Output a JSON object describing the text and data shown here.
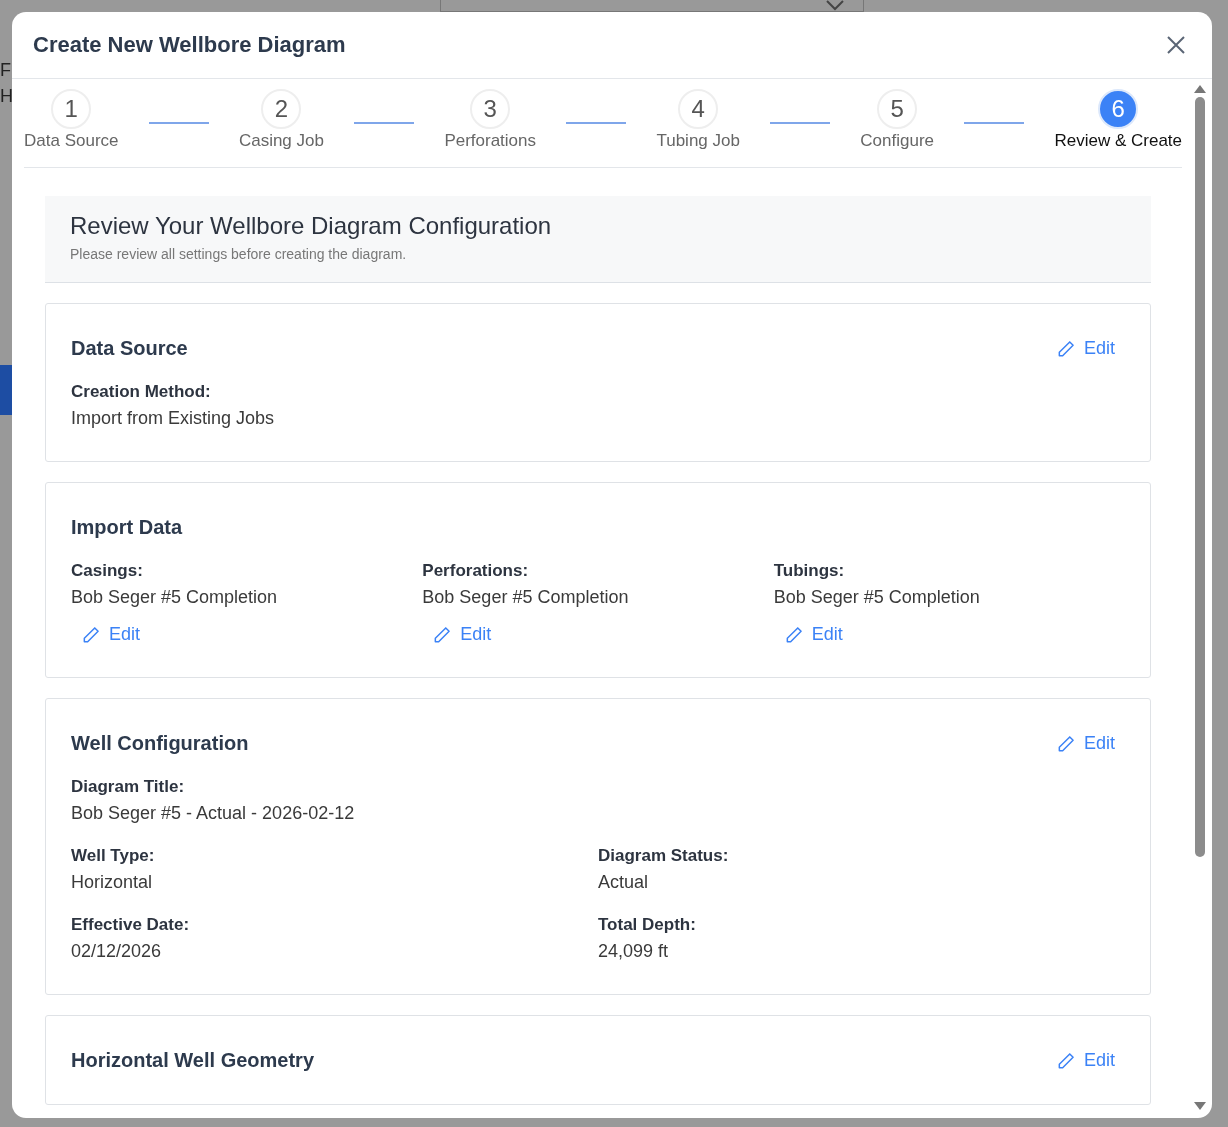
{
  "background": {
    "fragments": [
      "F",
      "H"
    ]
  },
  "dialog": {
    "title": "Create New Wellbore Diagram"
  },
  "steps": [
    {
      "number": "1",
      "label": "Data Source",
      "selected": false
    },
    {
      "number": "2",
      "label": "Casing Job",
      "selected": false
    },
    {
      "number": "3",
      "label": "Perforations",
      "selected": false
    },
    {
      "number": "4",
      "label": "Tubing Job",
      "selected": false
    },
    {
      "number": "5",
      "label": "Configure",
      "selected": false
    },
    {
      "number": "6",
      "label": "Review & Create",
      "selected": true
    }
  ],
  "review_header": {
    "title": "Review Your Wellbore Diagram Configuration",
    "subtitle": "Please review all settings before creating the diagram."
  },
  "sections": [
    {
      "title": "Data Source",
      "edit": "Edit",
      "rows": [
        [
          {
            "label": "Creation Method:",
            "value": "Import from Existing Jobs"
          }
        ]
      ]
    },
    {
      "title": "Import Data",
      "rows": [
        [
          {
            "label": "Casings:",
            "value": "Bob Seger #5 Completion",
            "edit": "Edit"
          },
          {
            "label": "Perforations:",
            "value": "Bob Seger #5 Completion",
            "edit": "Edit"
          },
          {
            "label": "Tubings:",
            "value": "Bob Seger #5 Completion",
            "edit": "Edit"
          }
        ]
      ]
    },
    {
      "title": "Well Configuration",
      "edit": "Edit",
      "rows": [
        [
          {
            "label": "Diagram Title:",
            "value": "Bob Seger #5 - Actual - 2026-02-12"
          }
        ],
        [
          {
            "label": "Well Type:",
            "value": "Horizontal"
          },
          {
            "label": "Diagram Status:",
            "value": "Actual"
          }
        ],
        [
          {
            "label": "Effective Date:",
            "value": "02/12/2026"
          },
          {
            "label": "Total Depth:",
            "value": "24,099 ft"
          }
        ]
      ]
    },
    {
      "title": "Horizontal Well Geometry",
      "edit": "Edit"
    }
  ]
}
